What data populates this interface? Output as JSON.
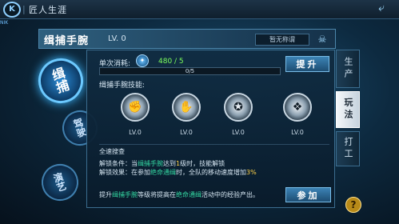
{
  "window": {
    "title": "匠人生涯",
    "sep": "|",
    "logo": "K",
    "corner_tag": "NIK"
  },
  "icons": {
    "logo": "k-logo-icon",
    "back": "back-arrow-icon",
    "emblem": "skull-emblem-icon",
    "gem": "gem-icon",
    "help": "question-icon"
  },
  "back_glyph": "⤶",
  "nav": {
    "items": [
      {
        "label": "缉捕",
        "active": true
      },
      {
        "label": "驾驶",
        "active": false
      },
      {
        "label": "演艺",
        "active": false
      }
    ]
  },
  "header": {
    "name": "缉捕手腕",
    "level": "LV. 0",
    "title_badge": "暂无称谓",
    "emblem_glyph": "☠"
  },
  "cost": {
    "label": "单次消耗:",
    "gem_glyph": "✦",
    "value": "480 / 5"
  },
  "progress": {
    "text": "0/5",
    "current": 0,
    "max": 5
  },
  "buttons": {
    "upgrade": "提升",
    "join": "参加"
  },
  "skills": {
    "label": "缉捕手腕技能:",
    "items": [
      {
        "glyph": "✊",
        "level": "LV.0"
      },
      {
        "glyph": "✋",
        "level": "LV.0"
      },
      {
        "glyph": "✪",
        "level": "LV.0"
      },
      {
        "glyph": "❖",
        "level": "LV.0"
      }
    ]
  },
  "detail": {
    "section_title": "全速搜查",
    "line1": {
      "a": "解锁条件：当",
      "b": "缉捕手腕",
      "c": "达到",
      "d": "1",
      "e": "级时，技能解锁"
    },
    "line2": {
      "a": "解锁效果：在参加",
      "b": "绝命通缉",
      "c": "时，全队的移动速度增加",
      "d": "3%"
    },
    "line3": {
      "a": "提升",
      "b": "缉捕手腕",
      "c": "等级将提高在",
      "d": "绝命通缉",
      "e": "活动中的经验产出。"
    }
  },
  "tabs": [
    {
      "label": "生产",
      "active": false
    },
    {
      "label": "玩法",
      "active": true
    },
    {
      "label": "打工",
      "active": false
    }
  ],
  "help_glyph": "?",
  "colors": {
    "accent": "#6cc9ff",
    "highlight_green": "#34d6a1",
    "highlight_yellow": "#ffd24a",
    "cost_green": "#7dff5c"
  }
}
